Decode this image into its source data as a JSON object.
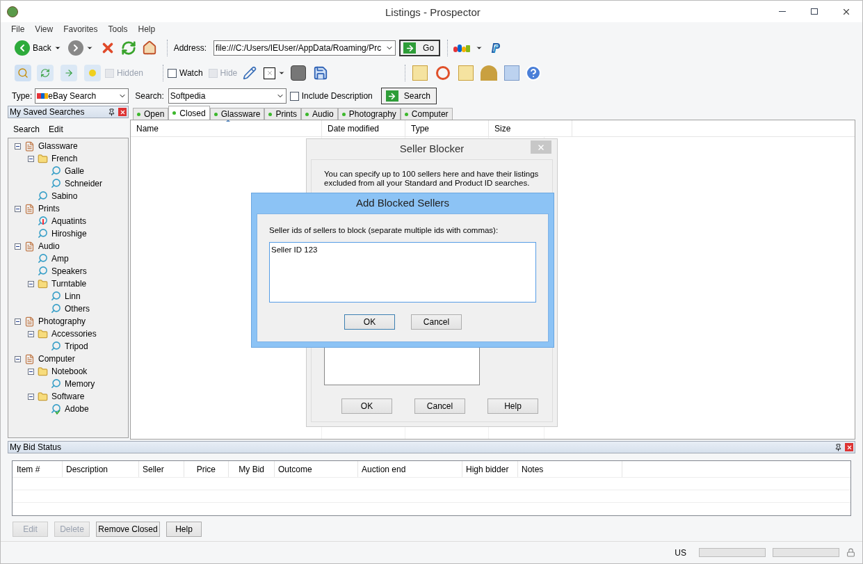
{
  "window": {
    "title": "Listings - Prospector"
  },
  "menu": [
    "File",
    "View",
    "Favorites",
    "Tools",
    "Help"
  ],
  "toolbar": {
    "back": "Back",
    "address_label": "Address:",
    "address": "file:///C:/Users/IEUser/AppData/Roaming/Prc",
    "go": "Go",
    "hidden": {
      "label": "Hidden",
      "checked": false,
      "disabled": true
    },
    "watch": {
      "label": "Watch",
      "checked": false,
      "disabled": false
    },
    "hide": {
      "label": "Hide",
      "checked": false,
      "disabled": true
    }
  },
  "search_bar": {
    "type_label": "Type:",
    "type_value": "eBay Search",
    "search_label": "Search:",
    "search_value": "Softpedia",
    "include_description": {
      "label": "Include Description",
      "checked": false,
      "disabled": false
    },
    "search_button": "Search"
  },
  "saved_searches": {
    "title": "My Saved Searches",
    "menu": [
      "Search",
      "Edit"
    ],
    "tree": [
      {
        "label": "Glassware",
        "kind": "category",
        "expanded": true,
        "children": [
          {
            "label": "French",
            "kind": "folder",
            "expanded": true,
            "children": [
              {
                "label": "Galle",
                "kind": "search"
              },
              {
                "label": "Schneider",
                "kind": "search"
              }
            ]
          },
          {
            "label": "Sabino",
            "kind": "search"
          }
        ]
      },
      {
        "label": "Prints",
        "kind": "category",
        "expanded": true,
        "children": [
          {
            "label": "Aquatints",
            "kind": "alert_search"
          },
          {
            "label": "Hiroshige",
            "kind": "search"
          }
        ]
      },
      {
        "label": "Audio",
        "kind": "category",
        "expanded": true,
        "children": [
          {
            "label": "Amp",
            "kind": "search"
          },
          {
            "label": "Speakers",
            "kind": "search"
          },
          {
            "label": "Turntable",
            "kind": "folder",
            "expanded": true,
            "children": [
              {
                "label": "Linn",
                "kind": "search"
              },
              {
                "label": "Others",
                "kind": "search"
              }
            ]
          }
        ]
      },
      {
        "label": "Photography",
        "kind": "category",
        "expanded": true,
        "children": [
          {
            "label": "Accessories",
            "kind": "folder",
            "expanded": true,
            "children": [
              {
                "label": "Tripod",
                "kind": "search"
              }
            ]
          }
        ]
      },
      {
        "label": "Computer",
        "kind": "category",
        "expanded": true,
        "children": [
          {
            "label": "Notebook",
            "kind": "folder",
            "expanded": true,
            "children": [
              {
                "label": "Memory",
                "kind": "search"
              }
            ]
          },
          {
            "label": "Software",
            "kind": "folder",
            "expanded": true,
            "children": [
              {
                "label": "Adobe",
                "kind": "done_search"
              }
            ]
          }
        ]
      }
    ]
  },
  "tabs": [
    {
      "label": "Open",
      "selected": false
    },
    {
      "label": "Closed",
      "selected": true
    },
    {
      "label": "Glassware",
      "selected": false
    },
    {
      "label": "Prints",
      "selected": false
    },
    {
      "label": "Audio",
      "selected": false
    },
    {
      "label": "Photography",
      "selected": false
    },
    {
      "label": "Computer",
      "selected": false
    }
  ],
  "columns": [
    {
      "label": "Name",
      "sorted": true
    },
    {
      "label": "Date modified",
      "sorted": false
    },
    {
      "label": "Type",
      "sorted": false
    },
    {
      "label": "Size",
      "sorted": false
    }
  ],
  "bid_status": {
    "title": "My Bid Status",
    "columns": [
      "Item #",
      "Description",
      "Seller",
      "Price",
      "My Bid",
      "Outcome",
      "Auction end",
      "High bidder",
      "Notes"
    ],
    "buttons": [
      {
        "label": "Edit",
        "disabled": true
      },
      {
        "label": "Delete",
        "disabled": true
      },
      {
        "label": "Remove Closed",
        "disabled": false
      },
      {
        "label": "Help",
        "disabled": false
      }
    ]
  },
  "status_bar": {
    "locale": "US"
  },
  "seller_blocker": {
    "title": "Seller Blocker",
    "message": "You can specify up to 100 sellers here and have their listings excluded from all your Standard and Product ID searches.",
    "buttons": [
      "OK",
      "Cancel",
      "Help"
    ]
  },
  "add_blocked_sellers": {
    "title": "Add Blocked Sellers",
    "prompt": "Seller ids of sellers to block (separate multiple ids with commas):",
    "value": "Seller ID 123",
    "buttons": [
      {
        "label": "OK",
        "default": true
      },
      {
        "label": "Cancel",
        "default": false
      }
    ]
  }
}
